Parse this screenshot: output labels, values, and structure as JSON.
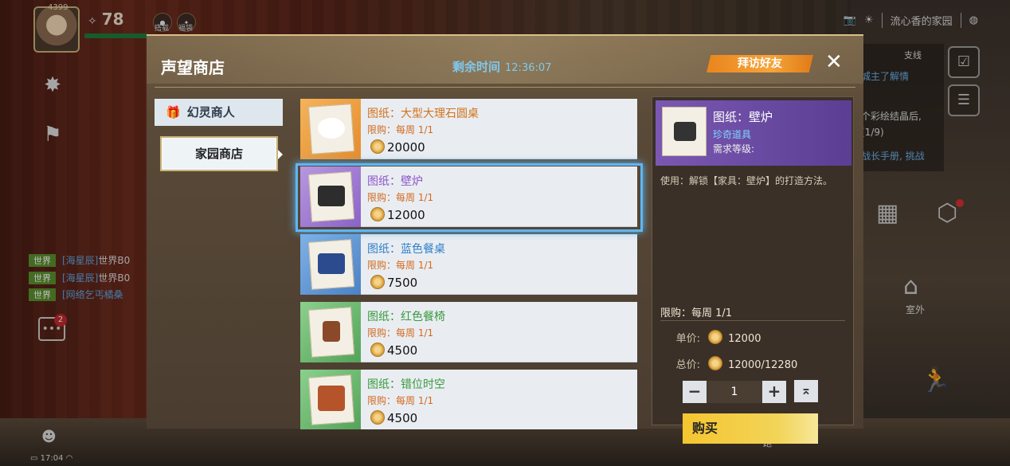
{
  "hud": {
    "power": "78",
    "avatar_badge": "4399",
    "mini1_label": "搭载",
    "mini2_label": "福袋",
    "home_name": "流心香的家园",
    "chat": [
      {
        "tag": "世界",
        "name": "[海星辰]",
        "text": "世界B0"
      },
      {
        "tag": "世界",
        "name": "[海星辰]",
        "text": "世界B0"
      },
      {
        "tag": "世界",
        "name": "[网络乞丐橘桑",
        "text": ""
      }
    ],
    "chat_badge": "2",
    "clock": "17:04",
    "side_tab": "支线",
    "side_lines": [
      "城主了解情",
      "个彩绘结晶后,",
      "(1/9)",
      "战长手册, 挑战"
    ],
    "outside_label": "室外",
    "run_label": "跑"
  },
  "dialog": {
    "title": "声望商店",
    "timer_label": "剩余时间",
    "timer_value": "12:36:07",
    "visit_button": "拜访好友",
    "close": "✕"
  },
  "tabs": [
    {
      "label": "幻灵商人",
      "icon": "gift-icon"
    },
    {
      "label": "家园商店",
      "icon": ""
    }
  ],
  "items": [
    {
      "name": "图纸：大型大理石圆桌",
      "limit": "限购：每周 1/1",
      "price": "20000",
      "color": "#d3721a",
      "thumb": "orange"
    },
    {
      "name": "图纸：壁炉",
      "limit": "限购：每周 1/1",
      "price": "12000",
      "color": "#8c55c9",
      "thumb": "purple"
    },
    {
      "name": "图纸：蓝色餐桌",
      "limit": "限购：每周 1/1",
      "price": "7500",
      "color": "#2f7fc7",
      "thumb": "blue"
    },
    {
      "name": "图纸：红色餐椅",
      "limit": "限购：每周 1/1",
      "price": "4500",
      "color": "#3a9a3c",
      "thumb": "green"
    },
    {
      "name": "图纸：错位时空",
      "limit": "限购：每周 1/1",
      "price": "4500",
      "color": "#3a9a3c",
      "thumb": "green"
    }
  ],
  "detail": {
    "name": "图纸：壁炉",
    "rarity": "珍奇道具",
    "requirement": "需求等级:",
    "description": "使用：解锁【家具：壁炉】的打造方法。",
    "limit": "限购：每周 1/1",
    "unit_label": "单价:",
    "unit_price": "12000",
    "total_label": "总价:",
    "total_price": "12000/12280",
    "quantity": "1",
    "buy_button": "购买"
  }
}
